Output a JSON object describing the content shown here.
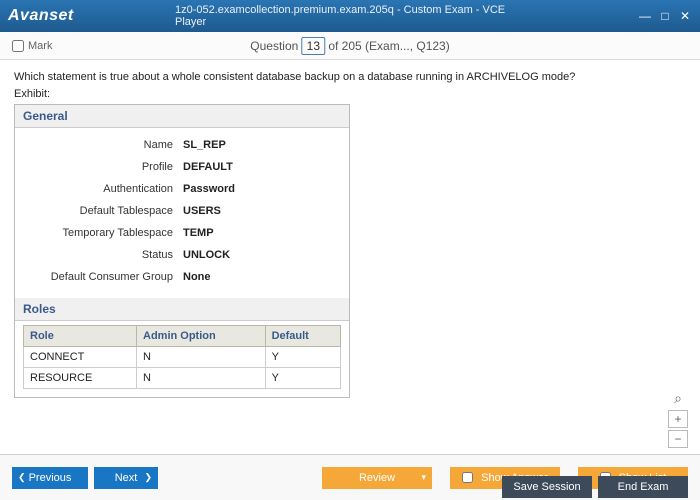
{
  "titlebar": {
    "logo": "Avanset",
    "title": "1z0-052.examcollection.premium.exam.205q - Custom Exam - VCE Player"
  },
  "subbar": {
    "mark_label": "Mark",
    "question_word": "Question",
    "question_num": "13",
    "question_suffix": " of 205 (Exam..., Q123)"
  },
  "question": {
    "text": "Which statement is true about a whole consistent database backup on a database running in ARCHIVELOG mode?",
    "exhibit_label": "Exhibit:"
  },
  "exhibit": {
    "general_header": "General",
    "fields": [
      {
        "label": "Name",
        "value": "SL_REP"
      },
      {
        "label": "Profile",
        "value": "DEFAULT"
      },
      {
        "label": "Authentication",
        "value": "Password"
      },
      {
        "label": "Default Tablespace",
        "value": "USERS"
      },
      {
        "label": "Temporary Tablespace",
        "value": "TEMP"
      },
      {
        "label": "Status",
        "value": "UNLOCK"
      },
      {
        "label": "Default Consumer Group",
        "value": "None"
      }
    ],
    "roles_header": "Roles",
    "roles_cols": [
      "Role",
      "Admin Option",
      "Default"
    ],
    "roles_rows": [
      [
        "CONNECT",
        "N",
        "Y"
      ],
      [
        "RESOURCE",
        "N",
        "Y"
      ]
    ]
  },
  "buttons": {
    "previous": "Previous",
    "next": "Next",
    "review": "Review",
    "show_answer": "Show Answer",
    "show_list": "Show List",
    "save_session": "Save Session",
    "end_exam": "End Exam"
  },
  "zoom": {
    "plus": "+",
    "minus": "−",
    "mag": "⌕"
  }
}
